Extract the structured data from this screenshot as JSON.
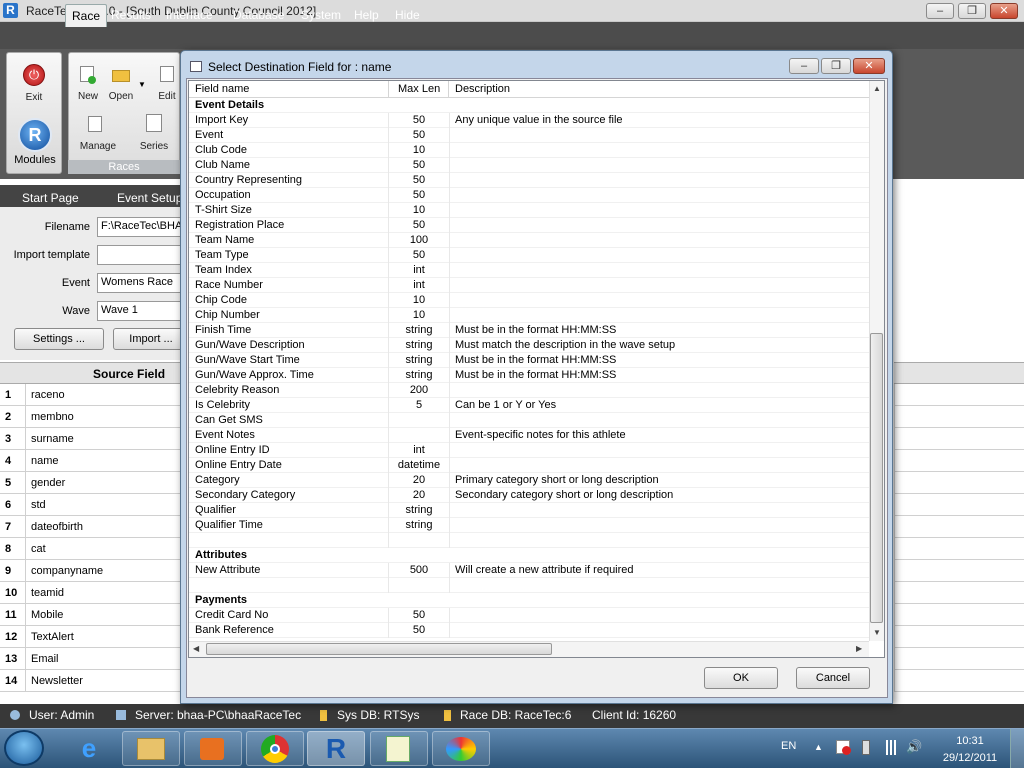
{
  "app": {
    "title": "RaceTec v3.34.0 - [South Dublin County Council  2012]",
    "logo": "R"
  },
  "menu": [
    "Race",
    "Results",
    "Interface",
    "Database",
    "System",
    "Help",
    "Hide"
  ],
  "ribbon": {
    "exit": "Exit",
    "modules": "Modules",
    "new": "New",
    "open": "Open",
    "edit": "Edit",
    "manage": "Manage",
    "series": "Series",
    "group_label": "Races"
  },
  "nav": {
    "start_page": "Start Page",
    "event_setup": "Event Setup"
  },
  "form": {
    "filename_label": "Filename",
    "filename_value": "F:\\RaceTec\\BHA",
    "import_template_label": "Import template",
    "import_template_value": "",
    "event_label": "Event",
    "event_value": "Womens Race",
    "wave_label": "Wave",
    "wave_value": "Wave 1",
    "settings_btn": "Settings ...",
    "import_btn": "Import ..."
  },
  "source_grid": {
    "header": "Source Field",
    "rows": [
      {
        "num": "1",
        "name": "raceno"
      },
      {
        "num": "2",
        "name": "membno"
      },
      {
        "num": "3",
        "name": "surname"
      },
      {
        "num": "4",
        "name": "name"
      },
      {
        "num": "5",
        "name": "gender"
      },
      {
        "num": "6",
        "name": "std"
      },
      {
        "num": "7",
        "name": "dateofbirth"
      },
      {
        "num": "8",
        "name": "cat"
      },
      {
        "num": "9",
        "name": "companyname"
      },
      {
        "num": "10",
        "name": "teamid"
      },
      {
        "num": "11",
        "name": "Mobile"
      },
      {
        "num": "12",
        "name": "TextAlert"
      },
      {
        "num": "13",
        "name": "Email"
      },
      {
        "num": "14",
        "name": "Newsletter"
      }
    ]
  },
  "status": {
    "user": "User: Admin",
    "server": "Server: bhaa-PC\\bhaaRaceTec",
    "sysdb": "Sys DB: RTSys",
    "racedb": "Race DB: RaceTec:6",
    "client": "Client Id: 16260"
  },
  "dialog": {
    "title": "Select Destination Field for : name",
    "col_field": "Field name",
    "col_len": "Max Len",
    "col_desc": "Description",
    "ok": "OK",
    "cancel": "Cancel",
    "rows": [
      {
        "f": "Event Details",
        "l": "",
        "d": "",
        "section": true
      },
      {
        "f": "Import Key",
        "l": "50",
        "d": "Any unique value in the source file"
      },
      {
        "f": "Event",
        "l": "50",
        "d": ""
      },
      {
        "f": "Club Code",
        "l": "10",
        "d": ""
      },
      {
        "f": "Club Name",
        "l": "50",
        "d": ""
      },
      {
        "f": "Country Representing",
        "l": "50",
        "d": ""
      },
      {
        "f": "Occupation",
        "l": "50",
        "d": ""
      },
      {
        "f": "T-Shirt Size",
        "l": "10",
        "d": ""
      },
      {
        "f": "Registration Place",
        "l": "50",
        "d": ""
      },
      {
        "f": "Team Name",
        "l": "100",
        "d": ""
      },
      {
        "f": "Team Type",
        "l": "50",
        "d": ""
      },
      {
        "f": "Team Index",
        "l": "int",
        "d": ""
      },
      {
        "f": "Race Number",
        "l": "int",
        "d": ""
      },
      {
        "f": "Chip Code",
        "l": "10",
        "d": ""
      },
      {
        "f": "Chip Number",
        "l": "10",
        "d": ""
      },
      {
        "f": "Finish Time",
        "l": "string",
        "d": "Must be in the format HH:MM:SS"
      },
      {
        "f": "Gun/Wave Description",
        "l": "string",
        "d": "Must match the description in the wave setup"
      },
      {
        "f": "Gun/Wave Start Time",
        "l": "string",
        "d": "Must be in the format HH:MM:SS"
      },
      {
        "f": "Gun/Wave Approx. Time",
        "l": "string",
        "d": "Must be in the format HH:MM:SS"
      },
      {
        "f": "Celebrity Reason",
        "l": "200",
        "d": ""
      },
      {
        "f": "Is Celebrity",
        "l": "5",
        "d": "Can be 1 or Y or Yes"
      },
      {
        "f": "Can Get SMS",
        "l": "",
        "d": ""
      },
      {
        "f": "Event Notes",
        "l": "",
        "d": "Event-specific notes for this athlete"
      },
      {
        "f": "Online Entry ID",
        "l": "int",
        "d": ""
      },
      {
        "f": "Online Entry Date",
        "l": "datetime",
        "d": ""
      },
      {
        "f": "Category",
        "l": "20",
        "d": "Primary category short or long description"
      },
      {
        "f": "Secondary Category",
        "l": "20",
        "d": "Secondary category short or long description"
      },
      {
        "f": "Qualifier",
        "l": "string",
        "d": ""
      },
      {
        "f": "Qualifier Time",
        "l": "string",
        "d": ""
      },
      {
        "f": "",
        "l": "",
        "d": ""
      },
      {
        "f": "Attributes",
        "l": "",
        "d": "",
        "section": true
      },
      {
        "f": "New Attribute",
        "l": "500",
        "d": "Will create a new attribute if required"
      },
      {
        "f": "",
        "l": "",
        "d": ""
      },
      {
        "f": "Payments",
        "l": "",
        "d": "",
        "section": true
      },
      {
        "f": "Credit Card No",
        "l": "50",
        "d": ""
      },
      {
        "f": "Bank Reference",
        "l": "50",
        "d": ""
      }
    ]
  },
  "tray": {
    "lang": "EN",
    "time": "10:31",
    "date": "29/12/2011"
  }
}
